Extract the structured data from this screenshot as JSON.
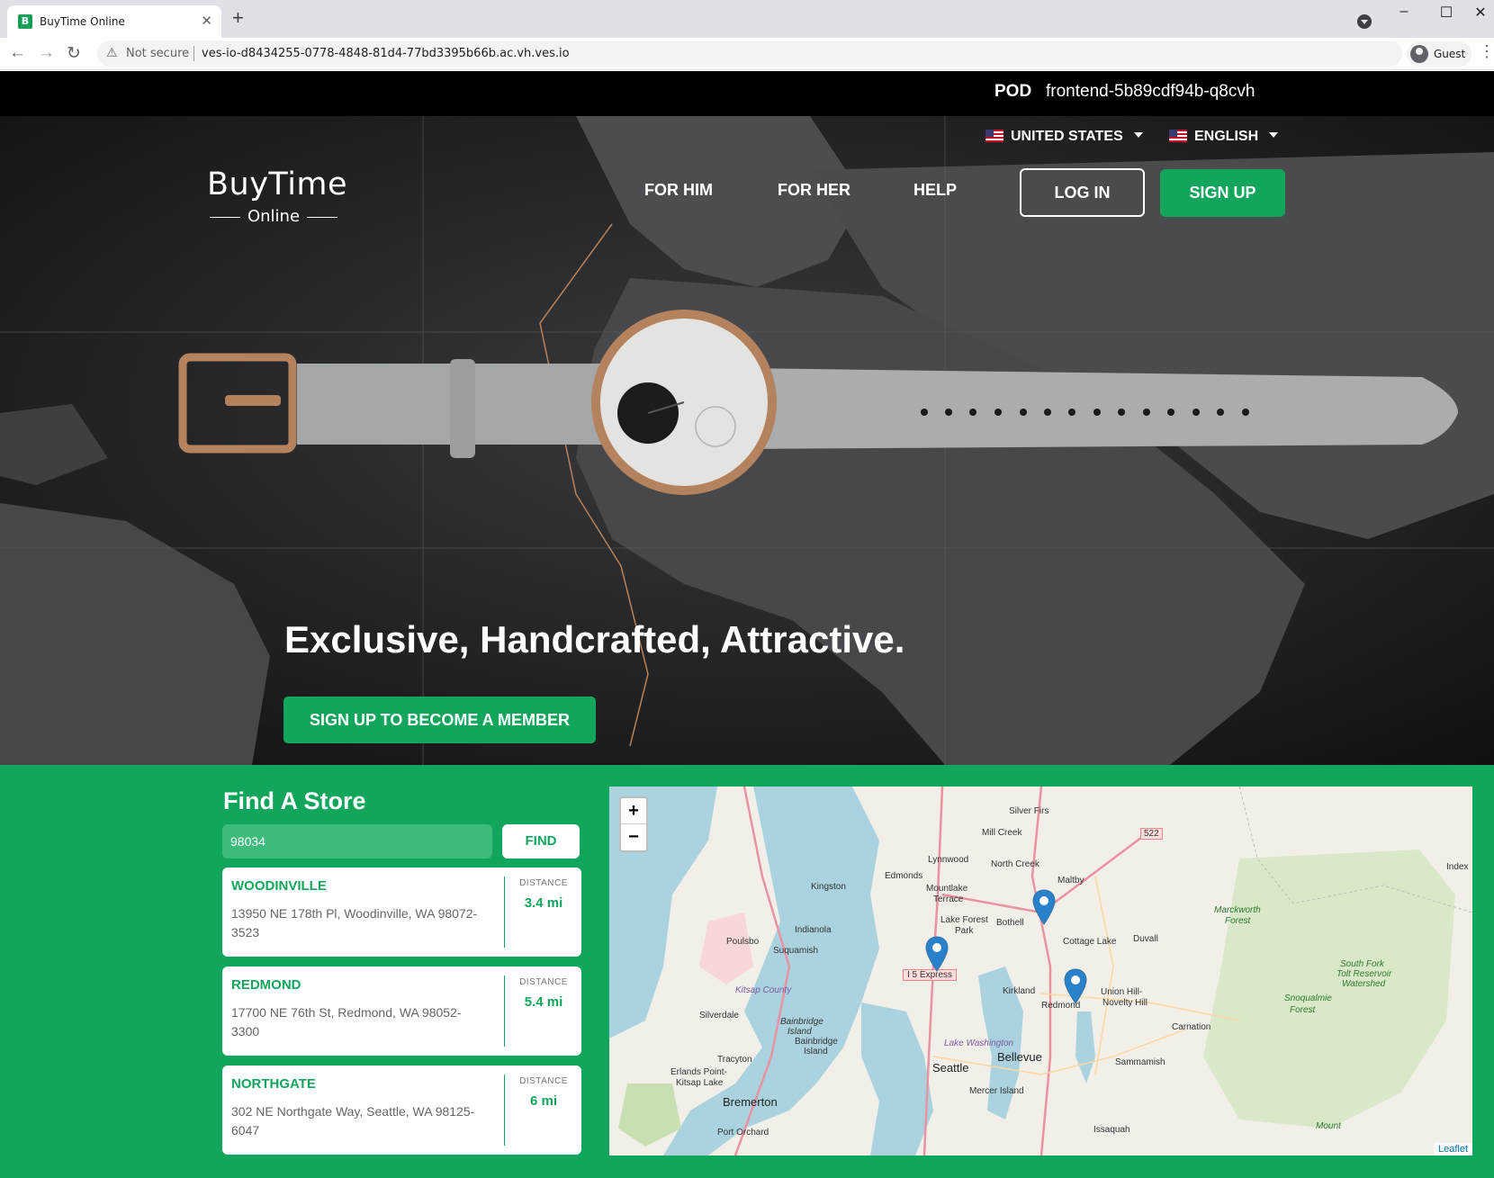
{
  "browser": {
    "tab_title": "BuyTime Online",
    "tab_favicon_letter": "B",
    "security_label": "Not secure",
    "url": "ves-io-d8434255-0778-4848-81d4-77bd3395b66b.ac.vh.ves.io",
    "profile_label": "Guest"
  },
  "pod": {
    "label": "POD",
    "name": "frontend-5b89cdf94b-q8cvh"
  },
  "header": {
    "country": "UNITED STATES",
    "language": "ENGLISH",
    "logo_main": "BuyTime",
    "logo_sub": "Online",
    "nav": [
      "FOR HIM",
      "FOR HER",
      "HELP"
    ],
    "login_label": "LOG IN",
    "signup_label": "SIGN UP"
  },
  "hero": {
    "headline": "Exclusive, Handcrafted, Attractive.",
    "cta_label": "SIGN UP TO BECOME A MEMBER"
  },
  "store_finder": {
    "title": "Find A Store",
    "zip_value": "98034",
    "find_label": "FIND",
    "distance_label": "DISTANCE",
    "stores": [
      {
        "name": "WOODINVILLE",
        "address": "13950 NE 178th Pl, Woodinville, WA 98072-3523",
        "distance": "3.4 mi"
      },
      {
        "name": "REDMOND",
        "address": "17700 NE 76th St, Redmond, WA 98052-3300",
        "distance": "5.4 mi"
      },
      {
        "name": "NORTHGATE",
        "address": "302 NE Northgate Way, Seattle, WA 98125-6047",
        "distance": "6 mi"
      }
    ]
  },
  "map": {
    "zoom_in": "+",
    "zoom_out": "−",
    "attribution": "Leaflet",
    "labels": {
      "silver_firs": "Silver Firs",
      "mill_creek": "Mill Creek",
      "lynnwood": "Lynnwood",
      "north_creek": "North Creek",
      "edmonds": "Edmonds",
      "kingston": "Kingston",
      "mountlake": "Mountlake",
      "terrace": "Terrace",
      "maltby": "Maltby",
      "lake_forest": "Lake Forest",
      "park": "Park",
      "bothell": "Bothell",
      "indianola": "Indianola",
      "poulsbo": "Poulsbo",
      "suquamish": "Suquamish",
      "cottage_lake": "Cottage Lake",
      "duvall": "Duvall",
      "i5_express": "I 5 Express",
      "kitsap_county": "Kitsap County",
      "kirkland": "Kirkland",
      "redmond": "Redmond",
      "union_hill": "Union Hill-",
      "novelty_hill": "Novelty Hill",
      "silverdale": "Silverdale",
      "bainbridge1": "Bainbridge",
      "bainbridge2": "Island",
      "bainbridge3": "Bainbridge",
      "bainbridge4": "Island",
      "carnation": "Carnation",
      "lake_washington": "Lake Washington",
      "tracyton": "Tracyton",
      "seattle": "Seattle",
      "bellevue": "Bellevue",
      "sammamish": "Sammamish",
      "erlands1": "Erlands Point-",
      "erlands2": "Kitsap Lake",
      "mercer_island": "Mercer Island",
      "bremerton": "Bremerton",
      "port_orchard": "Port Orchard",
      "issaquah": "Issaquah",
      "route_522": "522",
      "index": "Index",
      "marckworth1": "Marckworth",
      "marckworth2": "Forest",
      "snoqualmie1": "Snoqualmie",
      "snoqualmie2": "Forest",
      "south_fork1": "South Fork",
      "south_fork2": "Tolt Reservoir",
      "south_fork3": "Watershed",
      "mount": "Mount"
    }
  },
  "colors": {
    "brand_green": "#12a55c",
    "input_green": "#3dbb7b",
    "marker_blue": "#2a81cb"
  }
}
